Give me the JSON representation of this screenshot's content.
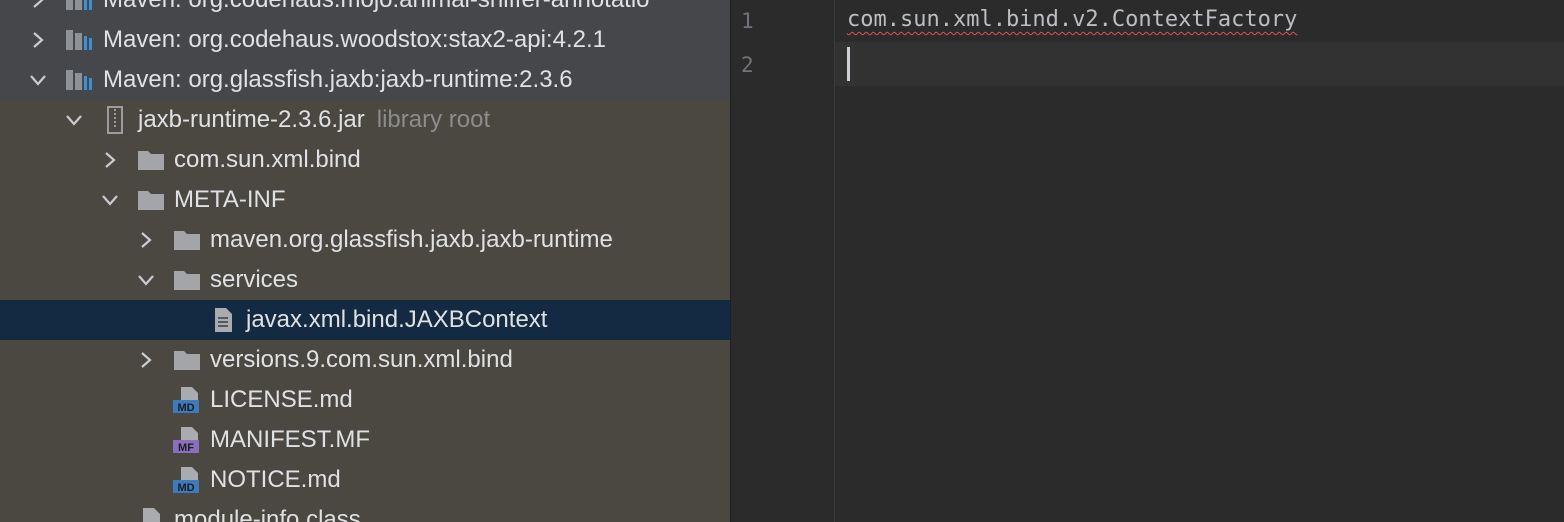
{
  "tree": {
    "rows": [
      {
        "label": "Maven: org.codehaus.mojo:animal-sniffer-annotatio"
      },
      {
        "label": "Maven: org.codehaus.woodstox:stax2-api:4.2.1"
      },
      {
        "label": "Maven: org.glassfish.jaxb:jaxb-runtime:2.3.6"
      },
      {
        "label": "jaxb-runtime-2.3.6.jar",
        "hint": "library root"
      },
      {
        "label": "com.sun.xml.bind"
      },
      {
        "label": "META-INF"
      },
      {
        "label": "maven.org.glassfish.jaxb.jaxb-runtime"
      },
      {
        "label": "services"
      },
      {
        "label": "javax.xml.bind.JAXBContext"
      },
      {
        "label": "versions.9.com.sun.xml.bind"
      },
      {
        "label": "LICENSE.md",
        "badge": "MD"
      },
      {
        "label": "MANIFEST.MF",
        "badge": "MF"
      },
      {
        "label": "NOTICE.md",
        "badge": "MD"
      },
      {
        "label": "module-info.class"
      }
    ]
  },
  "editor": {
    "line_numbers": [
      "1",
      "2"
    ],
    "lines": [
      "com.sun.xml.bind.v2.ContextFactory",
      ""
    ]
  },
  "colors": {
    "tree_bg": "#4b4741",
    "library_row_bg": "#45474a",
    "selected_row_bg": "#132a42",
    "editor_bg": "#2b2b2b",
    "current_line_bg": "#323232",
    "md_badge": "#3d7bbd",
    "mf_badge": "#8a6fc0",
    "error_squiggle": "#e05050"
  },
  "icons": {
    "library": "maven-library-icon",
    "jar": "jar-archive-icon",
    "folder": "folder-icon",
    "text_file": "text-file-icon",
    "markdown_file": "markdown-file-icon",
    "manifest_file": "manifest-file-icon",
    "class_file": "class-file-icon",
    "expand": "chevron-right-icon",
    "collapse": "chevron-down-icon"
  }
}
